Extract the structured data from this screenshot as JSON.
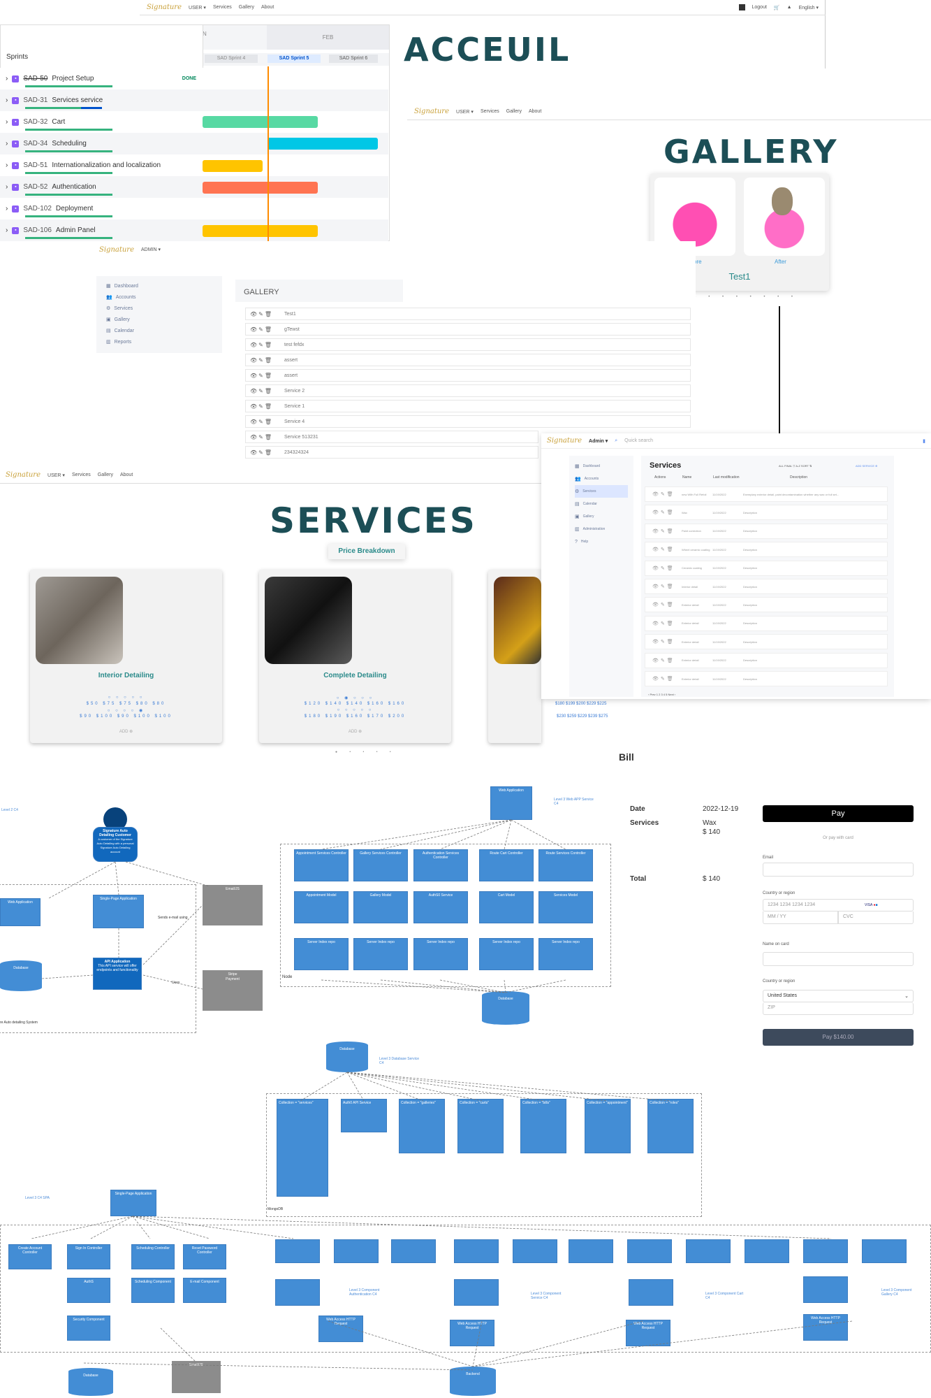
{
  "acceuil": {
    "title": "ACCEUIL",
    "nav": {
      "user": "USER ▾",
      "services": "Services",
      "gallery": "Gallery",
      "about": "About",
      "logout": "Logout",
      "language": "English ▾"
    }
  },
  "timeline": {
    "header_left": "Sprints",
    "month_jan": "N",
    "month_feb": "FEB",
    "sprints": [
      "SAD Sprint 4",
      "SAD Sprint 5",
      "SAD Sprint 6"
    ],
    "rows": [
      {
        "key": "SAD-50",
        "name": "Project Setup",
        "status": "DONE"
      },
      {
        "key": "SAD-31",
        "name": "Services service",
        "status": ""
      },
      {
        "key": "SAD-32",
        "name": "Cart",
        "status": ""
      },
      {
        "key": "SAD-34",
        "name": "Scheduling",
        "status": ""
      },
      {
        "key": "SAD-51",
        "name": "Internationalization and localization",
        "status": ""
      },
      {
        "key": "SAD-52",
        "name": "Authentication",
        "status": ""
      },
      {
        "key": "SAD-102",
        "name": "Deployment",
        "status": ""
      },
      {
        "key": "SAD-106",
        "name": "Admin Panel",
        "status": ""
      }
    ]
  },
  "gallery_page": {
    "title": "GALLERY",
    "nav": {
      "user": "USER ▾",
      "services": "Services",
      "gallery": "Gallery",
      "about": "About"
    },
    "card_before": "Before",
    "card_after": "After",
    "card_title": "Test1"
  },
  "admin_gallery": {
    "admin_label": "ADMIN ▾",
    "menu": [
      "Dashboard",
      "Accounts",
      "Services",
      "Gallery",
      "Calendar",
      "Reports"
    ],
    "heading": "GALLERY",
    "items": [
      "Test1",
      "gTewst",
      "test fefdx",
      "assert",
      "assert",
      "Service 2",
      "Service 1",
      "Service 4",
      "Service 513231",
      "234324324"
    ]
  },
  "services_page": {
    "title": "SERVICES",
    "nav": {
      "user": "USER ▾",
      "services": "Services",
      "gallery": "Gallery",
      "about": "About"
    },
    "price_button": "Price Breakdown",
    "cards": [
      {
        "name": "Interior Detailing",
        "row1": "$50 $75 $75 $80 $80",
        "row2": "$90 $100 $90 $100 $100",
        "add": "ADD ⊕"
      },
      {
        "name": "Complete Detailing",
        "row1": "$120 $140 $140 $160 $160",
        "row2": "$180 $190 $160 $170 $200",
        "add": "ADD ⊕"
      },
      {
        "name": "",
        "row1": "$180 $199 $200 $229 $225",
        "row2": "$230 $259 $229 $239 $275",
        "add": ""
      }
    ]
  },
  "services_admin": {
    "admin": "Admin ▾",
    "search": "Quick search",
    "menu": [
      "Dashboard",
      "Accounts",
      "Services",
      "Calendar",
      "Gallery",
      "Administration",
      "Help"
    ],
    "heading": "Services",
    "filters": "ALL  FINAL  ▽   A-Z  SORT ⇅",
    "add": "ADD SERVICE ⊕",
    "columns": [
      "Actions",
      "Name",
      "Last modification",
      "Description"
    ],
    "rows": [
      [
        "new With Full Refoil",
        "11/19/2022",
        "Exemplary exterior detail, paint decontamination whether any wax or full set..."
      ],
      [
        "Wax",
        "11/19/2022",
        "Description"
      ],
      [
        "Paint correction",
        "11/19/2022",
        "Description"
      ],
      [
        "Wheel ceramic coating",
        "11/19/2022",
        "Description"
      ],
      [
        "Ceramic coating",
        "11/19/2022",
        "Description"
      ],
      [
        "Interior detail",
        "11/19/2022",
        "Description"
      ],
      [
        "Exterior detail",
        "11/19/2022",
        "Description"
      ],
      [
        "Exterior detail",
        "11/19/2022",
        "Description"
      ],
      [
        "Exterior detail",
        "11/19/2022",
        "Description"
      ],
      [
        "Exterior detail",
        "11/19/2022",
        "Description"
      ],
      [
        "Exterior detail",
        "11/19/2022",
        "Description"
      ]
    ],
    "pagination": "‹ Prev  1  2  3  4  5  Next ›"
  },
  "bill": {
    "title": "Bill",
    "date_label": "Date",
    "date_value": "2022-12-19",
    "services_label": "Services",
    "services_value": "Wax",
    "services_price": "$ 140",
    "total_label": "Total",
    "total_value": "$ 140",
    "pay_button": " Pay",
    "or_pay": "Or pay with card",
    "email_label": "Email",
    "card_label": "Country or region",
    "card_placeholder": "1234 1234 1234 1234",
    "exp_placeholder": "MM / YY",
    "cvc_placeholder": "CVC",
    "name_label": "Name on card",
    "region_label": "Country or region",
    "region_value": "United States",
    "zip_placeholder": "ZIP",
    "submit": "Pay $140.00"
  },
  "c4": {
    "level2": "Level 2 C4",
    "customer": "Signature Auto Detailing Customer",
    "customer_desc": "A customer of the Signature Auto Detailing with a personal Signature Auto Detailing account",
    "webapp": "Web Application",
    "spa": "Single-Page Application",
    "api": "API Application",
    "api_desc": "This API service will offer endpoints and functionality",
    "database": "Database",
    "email": "Email/JS",
    "stripe": "Stripe",
    "payment": "Payment",
    "sends": "Sends e-mail using",
    "uses": "Uses",
    "system": "re Auto detailing System",
    "level3web": "Level 3 Web APP Service C4",
    "controllers": [
      "Appointment Services Controller",
      "Gallery Services Controller",
      "Authentication Services Controller",
      "Route Cart Controller",
      "Route Services Controller"
    ],
    "models": [
      "Appointment Model",
      "Gallery Model",
      "AuthS0 Service",
      "Cart Model",
      "Services Model"
    ],
    "repos": [
      "Server Index repo",
      "Server Index repo",
      "Server Index repo",
      "Server Index repo",
      "Server Index repo"
    ],
    "node": "Node",
    "level3db": "Level 3 Database Service C4",
    "collections": [
      "Collection = \"services\"",
      "Auth0 API Service",
      "Collection = \"galleries\"",
      "Collection = \"carts\"",
      "Collection = \"bills\"",
      "Collection = \"appointment\"",
      "Collection = \"roles\""
    ],
    "mongodb": "MongoDB",
    "level3spa": "Level 3 C4 SPA",
    "spa_items": [
      "Create Account Controller",
      "Sign In Controller",
      "Scheduling Controller",
      "Reset Password Controller",
      "AuthS",
      "Scheduling Component",
      "E-mail Component",
      "Security Component"
    ],
    "comp_auth": "Level 3 Component Authentication C4",
    "comp_service": "Level 3 Component Service C4",
    "comp_cart": "Level 3 Component Cart C4",
    "comp_gallery": "Level 3 Component Gallery C4",
    "backend": "Backend",
    "api_app": "API Application",
    "webreq": "Web Access HTTP Request"
  }
}
